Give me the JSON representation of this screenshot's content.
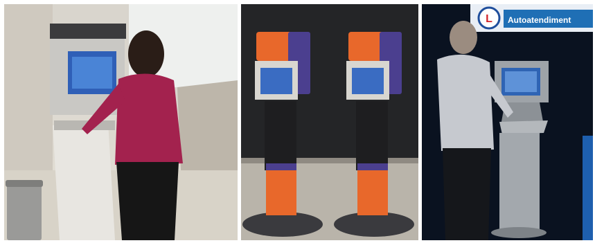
{
  "photos": [
    {
      "kind": "kiosk-photo-airport-woman"
    },
    {
      "kind": "kiosk-photo-two-orange-kiosks"
    },
    {
      "kind": "kiosk-photo-man-at-kiosk"
    }
  ],
  "photo3": {
    "banner_text": "Autoatendiment",
    "logo_letter": "L"
  },
  "colors": {
    "orange": "#e8682b",
    "purple": "#4b3f8f",
    "crimson": "#a8214a",
    "navy": "#0a1220"
  }
}
